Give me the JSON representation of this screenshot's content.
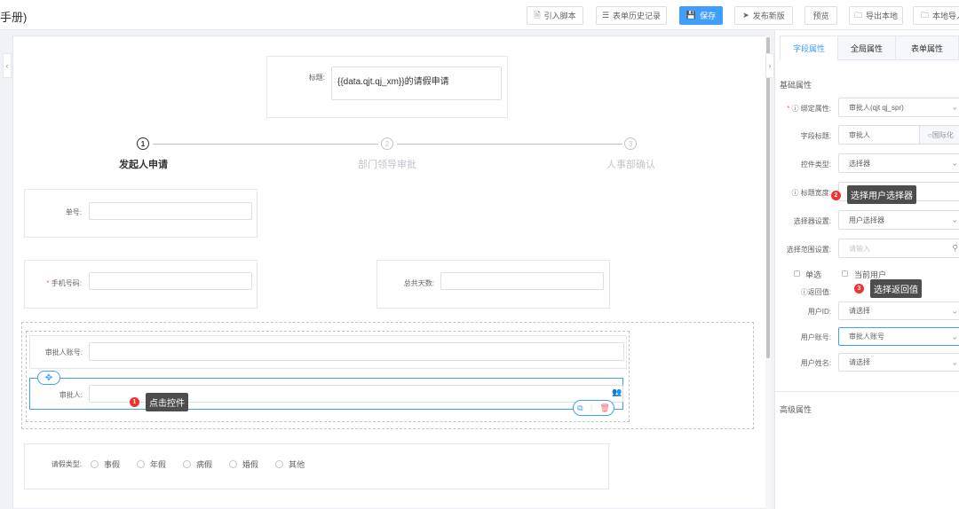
{
  "header": {
    "title": "手册)",
    "buttons": [
      {
        "name": "import-script-button",
        "icon": "file-icon",
        "glyph": "🗎",
        "label": "引入脚本"
      },
      {
        "name": "form-history-button",
        "icon": "list-icon",
        "glyph": "☰",
        "label": "表单历史记录"
      },
      {
        "name": "save-button",
        "icon": "save-icon",
        "glyph": "💾",
        "label": "保存"
      },
      {
        "name": "publish-button",
        "icon": "send-icon",
        "glyph": "➤",
        "label": "发布新版"
      },
      {
        "name": "preview-button",
        "icon": "",
        "glyph": "",
        "label": "预览"
      },
      {
        "name": "export-local-button",
        "icon": "folder-icon",
        "glyph": "🗀",
        "label": "导出本地"
      },
      {
        "name": "import-local-button",
        "icon": "folder-icon",
        "glyph": "🗀",
        "label": "本地导入"
      }
    ]
  },
  "form": {
    "title_label": "标题:",
    "title_value": "{{data.qjt.qj_xm}}的请假申请",
    "steps": [
      {
        "num": "1",
        "label": "发起人申请",
        "active": true
      },
      {
        "num": "2",
        "label": "部门领导审批",
        "active": false
      },
      {
        "num": "3",
        "label": "人事部确认",
        "active": false
      }
    ],
    "order_no_label": "单号:",
    "phone_label": "手机号码:",
    "total_days_label": "总共天数:",
    "approver_account_label": "审批人账号:",
    "approver_label": "审批人:",
    "leave_type_label": "请假类型:",
    "leave_types": [
      "事假",
      "年假",
      "病假",
      "婚假",
      "其他"
    ]
  },
  "annotations": [
    {
      "num": "1",
      "text": "点击控件"
    },
    {
      "num": "2",
      "text": "选择用户选择器"
    },
    {
      "num": "3",
      "text": "选择返回值"
    }
  ],
  "panel": {
    "tabs": [
      {
        "label": "字段属性",
        "active": true
      },
      {
        "label": "全局属性",
        "active": false
      },
      {
        "label": "表单属性",
        "active": false
      }
    ],
    "basic_section": "基础属性",
    "advanced_section": "高级属性",
    "bind_attr_label": "绑定属性:",
    "bind_attr_value": "审批人(qjt qj_spr)",
    "field_title_label": "字段标题:",
    "field_title_value": "审批人",
    "i18n_label": "国际化",
    "control_type_label": "控件类型:",
    "control_type_value": "选择器",
    "title_width_label": "标题宽度:",
    "selector_setting_label": "选择器设置:",
    "selector_setting_value": "用户选择器",
    "scope_label": "选择范围设置:",
    "scope_placeholder": "请输入",
    "single_label": "单选",
    "current_user_label": "当前用户",
    "return_value_label": "返回值:",
    "user_id_label": "用户ID:",
    "user_id_value": "请选择",
    "user_account_label": "用户账号:",
    "user_account_value": "审批人账号",
    "user_name_label": "用户姓名:",
    "user_name_value": "请选择"
  }
}
